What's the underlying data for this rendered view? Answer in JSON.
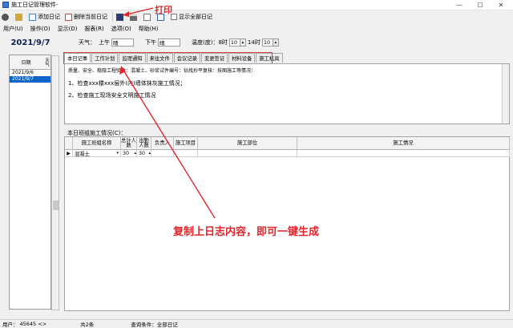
{
  "window": {
    "title": "施工日记管理软件-",
    "min": "—",
    "max": "☐",
    "close": "✕"
  },
  "toolbar": {
    "add": "添加日记",
    "delete": "删除当前日记",
    "show_all": "显示全部日记"
  },
  "menu": [
    "用户(U)",
    "操作(O)",
    "显示(D)",
    "报表(R)",
    "选项(O)",
    "帮助(H)"
  ],
  "left": {
    "date": "2021/9/7",
    "col_date": "日期",
    "col_weather": "天气",
    "rows": [
      "2021/9/6",
      "2021/9/7"
    ]
  },
  "form": {
    "weather": "天气：",
    "am": "上午",
    "am_val": "晴",
    "pm": "下午",
    "pm_val": "晴",
    "temp": "温度(度)：8时",
    "t1": "10",
    "t2_label": "14时",
    "t2": "10"
  },
  "tabs": [
    "本日记事",
    "工作计划",
    "监理通知",
    "来往文件",
    "会议记录",
    "变更签证",
    "材料设备",
    "施工机具"
  ],
  "content": {
    "subline": "质量、安全、稳隐工程验收：混凝土、砂浆试件编号：钻找抄平复核：技图施工等情况：",
    "line1": "1、检查xxx楼xxx层外(内)墙体抹灰施工情况；",
    "line2": "2、检查施工现场安全文明施工情况"
  },
  "team": {
    "label": "本日班组施工情况(C)：",
    "headers": [
      "施工班组名称",
      "总计人数",
      "出勤人数",
      "负责人",
      "施工项目",
      "施工部位",
      "施工情况"
    ],
    "row": {
      "name": "混凝土",
      "total": "30",
      "present": "30"
    }
  },
  "status": {
    "user": "用户：",
    "user_val": "45645 <>",
    "count": "共2条",
    "cond": "查询条件：全部日记"
  },
  "annotations": {
    "print": "打印",
    "copy": "复制上日志内容，即可一键生成",
    "color": "#e2252b"
  }
}
